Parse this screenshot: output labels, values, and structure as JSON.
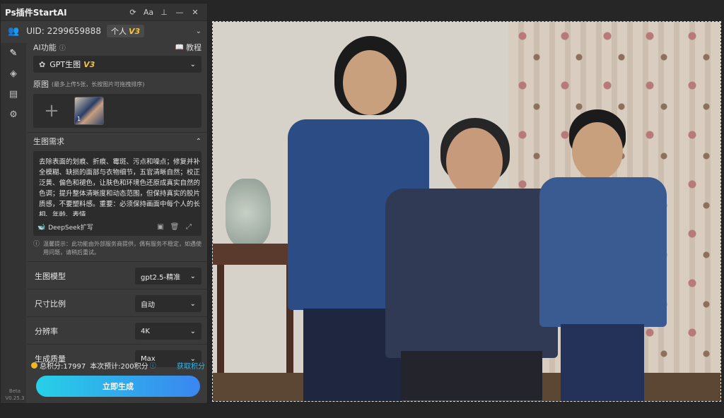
{
  "window": {
    "title": "Ps插件StartAI"
  },
  "titlebar_icons": [
    "refresh-icon",
    "font-size-icon",
    "pin-icon",
    "minimize-icon",
    "close-icon"
  ],
  "font_icon_text": "Aa",
  "user": {
    "uid_label": "UID: 2299659888",
    "tier": "个人",
    "tier_version": "V3"
  },
  "ai_function": {
    "label": "AI功能",
    "tutorial": "教程",
    "selected": "GPT生图",
    "version": "V3"
  },
  "original": {
    "label": "原图",
    "hint": "(最多上传5张，长按图片可拖拽排序)",
    "thumb_index": "1"
  },
  "prompt": {
    "label": "生图需求",
    "text": "去除表面的划痕、折痕、霉斑、污点和噪点；修复并补全模糊、缺损的面部与衣物细节，五官清晰自然；校正泛黄、偏色和褪色，让肤色和环境色还原成真实自然的色调；提升整体清晰度和动态范围，但保持真实的胶片质感，不要塑料感。重要：必须保持画面中每个人的长相、年龄、表情",
    "deepseek": "DeepSeek扩写"
  },
  "notice": "温馨提示：此功能由外部服务商提供，偶有服务不稳定，如遇使用问题，请稍后重试。",
  "settings": [
    {
      "label": "生图模型",
      "value": "gpt2.5-精准"
    },
    {
      "label": "尺寸比例",
      "value": "自动"
    },
    {
      "label": "分辨率",
      "value": "4K"
    },
    {
      "label": "生成质量",
      "value": "Max"
    }
  ],
  "points": {
    "total": "总积分:17997",
    "estimate": "本次预计:200积分",
    "get": "获取积分"
  },
  "generate_button": "立即生成",
  "beta": {
    "tag": "Beta",
    "version": "V0.25.3"
  }
}
